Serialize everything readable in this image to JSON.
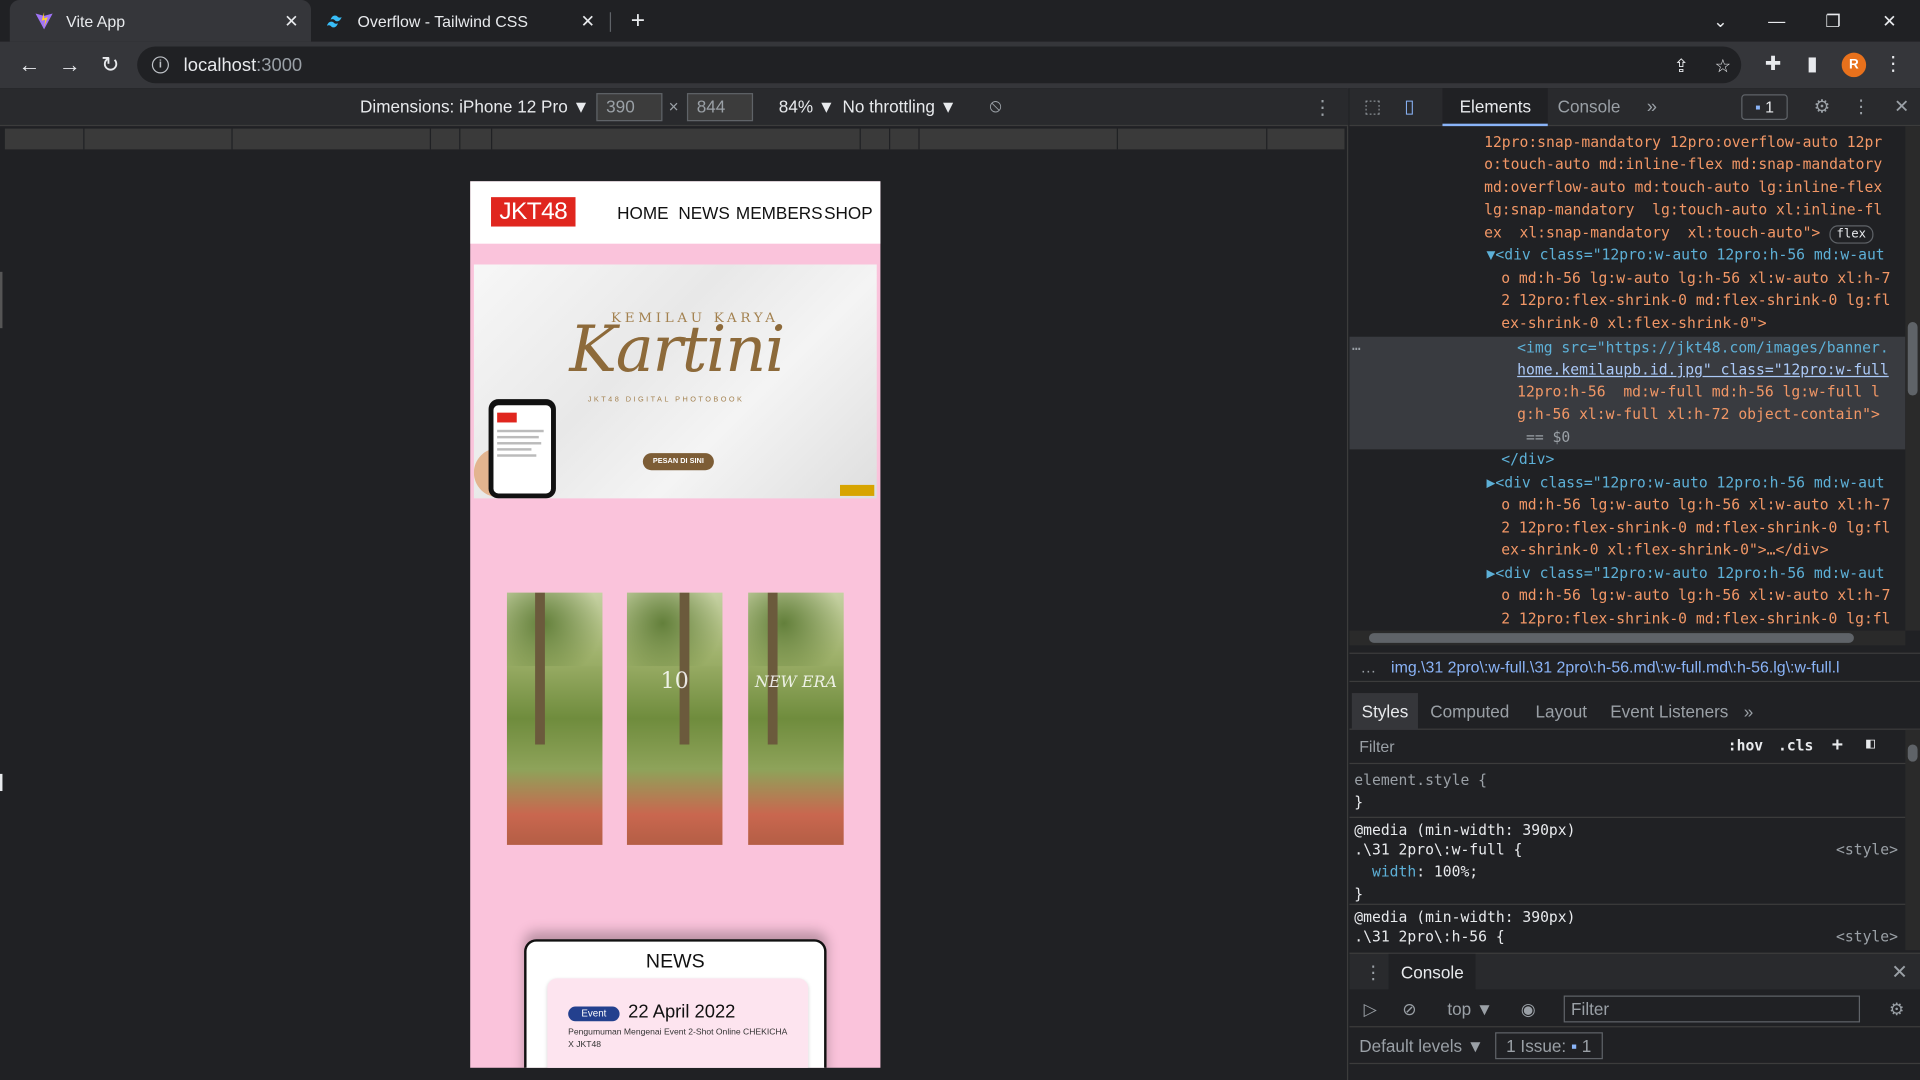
{
  "browser": {
    "tabs": [
      {
        "title": "Vite App",
        "favicon": "vite-icon",
        "active": true
      },
      {
        "title": "Overflow - Tailwind CSS",
        "favicon": "tailwind-icon",
        "active": false
      }
    ],
    "url_host": "localhost",
    "url_port": ":3000",
    "avatar_letter": "R",
    "avatar_color": "#e8711c"
  },
  "device_toolbar": {
    "dimensions_label": "Dimensions: iPhone 12 Pro ▼",
    "width": "390",
    "times": "×",
    "height": "844",
    "zoom": "84% ▼",
    "throttling": "No throttling ▼"
  },
  "site": {
    "logo": "JKT48",
    "nav": [
      "HOME",
      "NEWS",
      "MEMBERS",
      "SHOP"
    ],
    "banner": {
      "subtitle": "KEMILAU KARYA",
      "title": "Kartini",
      "tagline": "JKT48 DIGITAL PHOTOBOOK",
      "order_button": "PESAN DI SINI"
    },
    "photos": [
      {
        "caption": ""
      },
      {
        "caption": "10"
      },
      {
        "caption": "NEW ERA"
      }
    ],
    "news": {
      "title": "NEWS",
      "items": [
        {
          "badge": "Event",
          "date": "22 April 2022",
          "desc": "Pengumuman Mengenai Event 2-Shot Online CHEKICHA X JKT48"
        }
      ]
    },
    "bg_color": "#fac3db"
  },
  "devtools": {
    "tabs": [
      "Elements",
      "Console"
    ],
    "issues_count": "1",
    "dom_lines": [
      {
        "t": "12pro:snap-mandatory 12pro:overflow-auto 12pr",
        "cls": "c-val"
      },
      {
        "t": "o:touch-auto md:inline-flex md:snap-mandatory",
        "cls": "c-val"
      },
      {
        "t": "md:overflow-auto md:touch-auto lg:inline-flex",
        "cls": "c-val"
      },
      {
        "t": "lg:snap-mandatory  lg:touch-auto xl:inline-fl",
        "cls": "c-val"
      },
      {
        "t": "ex  xl:snap-mandatory  xl:touch-auto\">",
        "cls": "c-val"
      },
      {
        "t": "▼<div class=\"12pro:w-auto 12pro:h-56 md:w-aut",
        "cls": "c-tag"
      },
      {
        "t": "o md:h-56 lg:w-auto lg:h-56 xl:w-auto xl:h-7",
        "cls": "c-val"
      },
      {
        "t": "2 12pro:flex-shrink-0 md:flex-shrink-0 lg:fl",
        "cls": "c-val"
      },
      {
        "t": "ex-shrink-0 xl:flex-shrink-0\">",
        "cls": "c-val"
      },
      {
        "t": "<img src=\"https://jkt48.com/images/banner.",
        "cls": "c-tag"
      },
      {
        "t": "home.kemilaupb.id.jpg\" class=\"12pro:w-full",
        "cls": "c-link"
      },
      {
        "t": "12pro:h-56  md:w-full md:h-56 lg:w-full l",
        "cls": "c-val"
      },
      {
        "t": "g:h-56 xl:w-full xl:h-72 object-contain\">",
        "cls": "c-val"
      },
      {
        "t": " == $0",
        "cls": "c-dim"
      },
      {
        "t": "</div>",
        "cls": "c-tag"
      },
      {
        "t": "▶<div class=\"12pro:w-auto 12pro:h-56 md:w-aut",
        "cls": "c-tag"
      },
      {
        "t": "o md:h-56 lg:w-auto lg:h-56 xl:w-auto xl:h-7",
        "cls": "c-val"
      },
      {
        "t": "2 12pro:flex-shrink-0 md:flex-shrink-0 lg:fl",
        "cls": "c-val"
      },
      {
        "t": "ex-shrink-0 xl:flex-shrink-0\">…</div>",
        "cls": "c-val"
      },
      {
        "t": "▶<div class=\"12pro:w-auto 12pro:h-56 md:w-aut",
        "cls": "c-tag"
      },
      {
        "t": "o md:h-56 lg:w-auto lg:h-56 xl:w-auto xl:h-7",
        "cls": "c-val"
      },
      {
        "t": "2 12pro:flex-shrink-0 md:flex-shrink-0 lg:fl",
        "cls": "c-val"
      }
    ],
    "flex_badge": "flex",
    "breadcrumb": "img.\\31 2pro\\:w-full.\\31 2pro\\:h-56.md\\:w-full.md\\:h-56.lg\\:w-full.l",
    "subtabs": [
      "Styles",
      "Computed",
      "Layout",
      "Event Listeners"
    ],
    "styles_filter_placeholder": "Filter",
    "hov": ":hov",
    "cls": ".cls",
    "rules": [
      "element.style {",
      "}",
      "@media (min-width: 390px)",
      ".\\31 2pro\\:w-full {",
      "  width: 100%;",
      "}",
      "@media (min-width: 390px)",
      ".\\31 2pro\\:h-56 {"
    ],
    "rule_source": "<style>",
    "drawer_title": "Console",
    "console_context": "top ▼",
    "console_filter_placeholder": "Filter",
    "levels": "Default levels ▼",
    "issues_label": "1 Issue:",
    "issues_num": "1"
  }
}
